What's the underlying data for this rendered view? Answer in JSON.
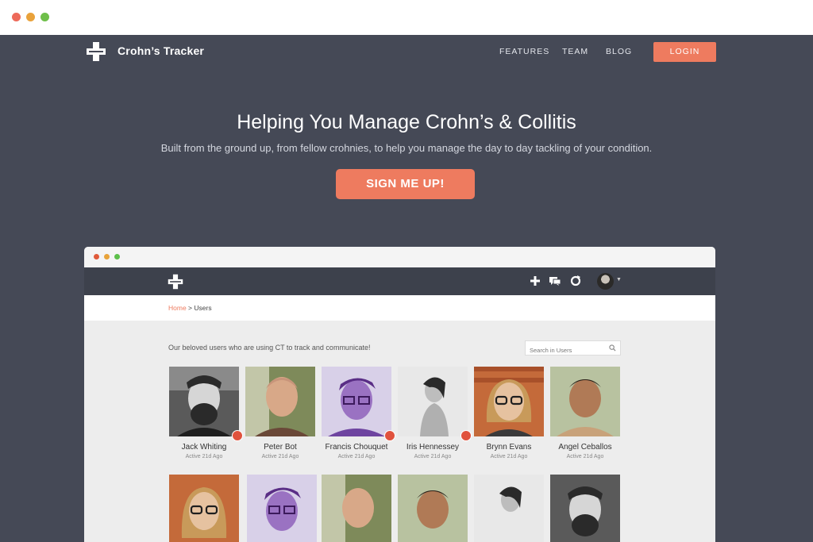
{
  "browser": {
    "dot_colors": [
      "#ed6a5a",
      "#e9a23b",
      "#6fbf4a"
    ]
  },
  "nav": {
    "brand": "Crohn’s Tracker",
    "links": [
      "FEATURES",
      "TEAM",
      "BLOG"
    ],
    "login_label": "LOGIN"
  },
  "hero": {
    "headline": "Helping You Manage Crohn’s & Collitis",
    "subline": "Built from the ground up, from fellow crohnies, to help you manage the day to day tackling of your condition.",
    "cta_label": "SIGN ME UP!"
  },
  "mock": {
    "window_dot_colors": [
      "#e05a3a",
      "#e8a33a",
      "#5cbf4a"
    ],
    "nav_icons": [
      "plus-icon",
      "chat-icon",
      "refresh-icon",
      "user-avatar"
    ],
    "breadcrumb": {
      "home": "Home",
      "separator": " > ",
      "current": "Users"
    },
    "intro": "Our beloved users who are using CT to track and communicate!",
    "search_placeholder": "Search in Users",
    "users_row1": [
      {
        "name": "Jack Whiting",
        "active": "Active 21d Ago",
        "badge": true
      },
      {
        "name": "Peter Bot",
        "active": "Active 21d Ago",
        "badge": false
      },
      {
        "name": "Francis Chouquet",
        "active": "Active 21d Ago",
        "badge": true
      },
      {
        "name": "Iris Hennessey",
        "active": "Active 21d Ago",
        "badge": true
      },
      {
        "name": "Brynn Evans",
        "active": "Active 21d Ago",
        "badge": false
      },
      {
        "name": "Angel Ceballos",
        "active": "Active 21d Ago",
        "badge": false
      }
    ]
  },
  "colors": {
    "hero_bg": "#454956",
    "accent": "#ee7b5f",
    "badge": "#e0523d"
  }
}
